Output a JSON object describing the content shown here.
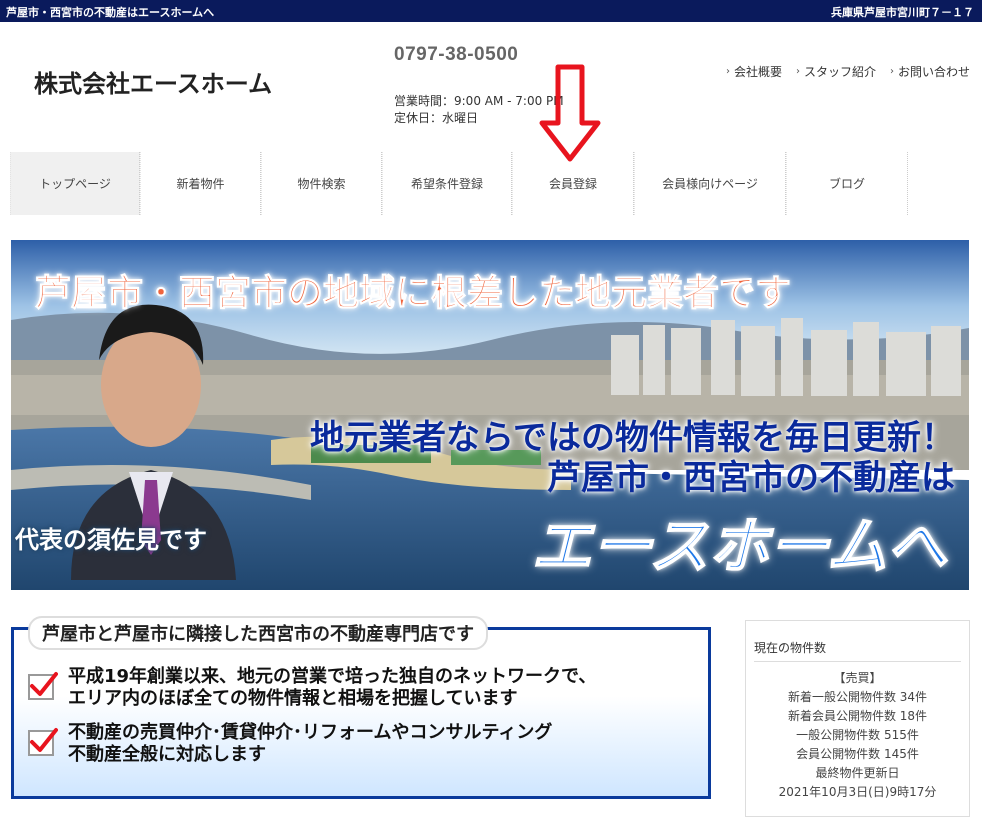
{
  "topbar": {
    "left": "芦屋市・西宮市の不動産はエースホームへ",
    "right": "兵庫県芦屋市宮川町７－１７"
  },
  "header": {
    "company": "株式会社エースホーム",
    "phone": "0797-38-0500",
    "hours": "営業時間：9:00 AM - 7:00 PM",
    "holiday": "定休日：水曜日",
    "links": [
      "会社概要",
      "スタッフ紹介",
      "お問い合わせ"
    ]
  },
  "nav": {
    "items": [
      "トップページ",
      "新着物件",
      "物件検索",
      "希望条件登録",
      "会員登録",
      "会員様向けページ",
      "ブログ"
    ]
  },
  "banner": {
    "line1": "芦屋市・西宮市の地域に根差した地元業者です",
    "line2": "地元業者ならではの物件情報を毎日更新！",
    "line3": "芦屋市・西宮市の不動産は",
    "line4": "エースホームへ",
    "caption": "代表の須佐見です"
  },
  "info": {
    "heading": "芦屋市と芦屋市に隣接した西宮市の不動産専門店です",
    "points": [
      {
        "l1": "平成19年創業以来、地元の営業で培った独自のネットワークで、",
        "l2": "エリア内のほぼ全ての物件情報と相場を把握しています"
      },
      {
        "l1": "不動産の売買仲介･賃貸仲介･リフォームやコンサルティング",
        "l2": "不動産全般に対応します"
      }
    ]
  },
  "side": {
    "title": "現在の物件数",
    "lines": [
      "【売買】",
      "新着一般公開物件数 34件",
      "新着会員公開物件数 18件",
      "一般公開物件数 515件",
      "会員公開物件数 145件",
      "最終物件更新日",
      "2021年10月3日(日)9時17分"
    ]
  },
  "colors": {
    "topbar": "#0a1a5c",
    "accent_red": "#e8141e",
    "banner_blue": "#0a2a9c"
  }
}
